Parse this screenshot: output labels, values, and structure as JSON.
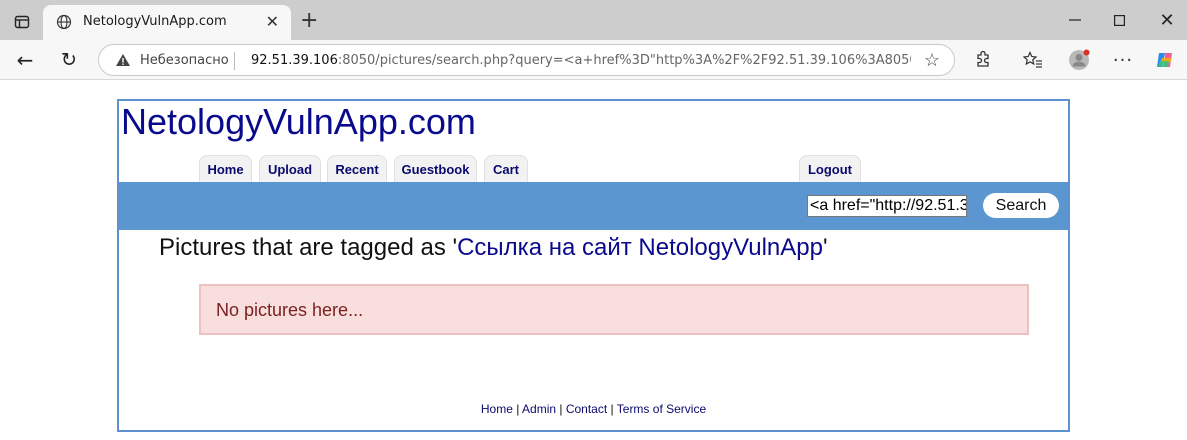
{
  "browser": {
    "tab_title": "NetologyVulnApp.com",
    "security_label": "Небезопасно",
    "url_host": "92.51.39.106",
    "url_rest": ":8050/pictures/search.php?query=<a+href%3D\"http%3A%2F%2F92.51.39.106%3A8050%2F..."
  },
  "site": {
    "logo": "NetologyVulnApp.com",
    "nav": {
      "home": "Home",
      "upload": "Upload",
      "recent": "Recent",
      "guestbook": "Guestbook",
      "cart": "Cart",
      "logout": "Logout"
    },
    "search": {
      "value": "<a href=\"http://92.51.3",
      "button": "Search"
    },
    "heading_prefix": "Pictures that are tagged as '",
    "heading_tag": "Ссылка на сайт NetologyVulnApp",
    "heading_suffix": "'",
    "alert": "No pictures here...",
    "footer": {
      "home": "Home",
      "admin": "Admin",
      "contact": "Contact",
      "terms": "Terms of Service",
      "separator": " | "
    }
  }
}
